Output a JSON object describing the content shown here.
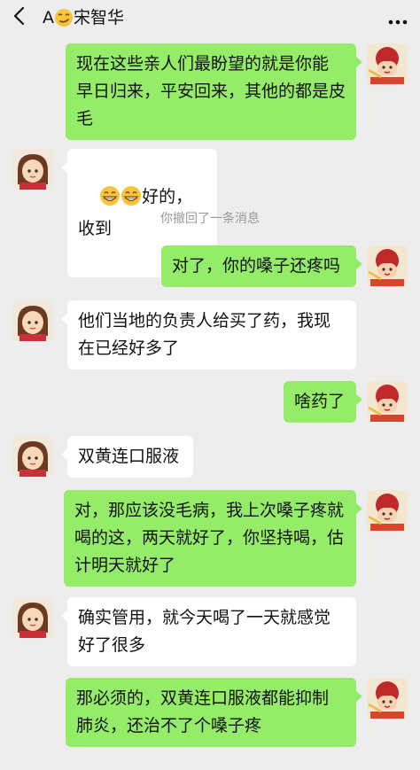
{
  "header": {
    "title_prefix": "A",
    "title_name": "宋智华",
    "title_emoji_icon": "smirk-face-icon",
    "back_icon": "chevron-left-icon",
    "more_icon": "more-dots-icon"
  },
  "messages": [
    {
      "side": "out",
      "text": "现在这些亲人们最盼望的就是你能\n早日归来，平安回来，其他的都是皮\n毛"
    },
    {
      "side": "in",
      "emoji": "grin-face-icon",
      "text": "好的，收到"
    },
    {
      "side": "system",
      "text": "你撤回了一条消息"
    },
    {
      "side": "out",
      "text": "对了，你的嗓子还疼吗"
    },
    {
      "side": "in",
      "text": "他们当地的负责人给买了药，我现\n在已经好多了"
    },
    {
      "side": "out",
      "text": "啥药了"
    },
    {
      "side": "in",
      "text": "双黄连口服液"
    },
    {
      "side": "out",
      "text": "对，那应该没毛病，我上次嗓子疼就\n喝的这，两天就好了，你坚持喝，估\n计明天就好了"
    },
    {
      "side": "in",
      "text": "确实管用，就今天喝了一天就感觉\n好了很多"
    },
    {
      "side": "out",
      "text": "那必须的，双黄连口服液都能抑制\n肺炎，还治不了个嗓子疼"
    }
  ],
  "colors": {
    "background": "#ededed",
    "outgoing_bubble": "#95ec69",
    "incoming_bubble": "#ffffff"
  }
}
